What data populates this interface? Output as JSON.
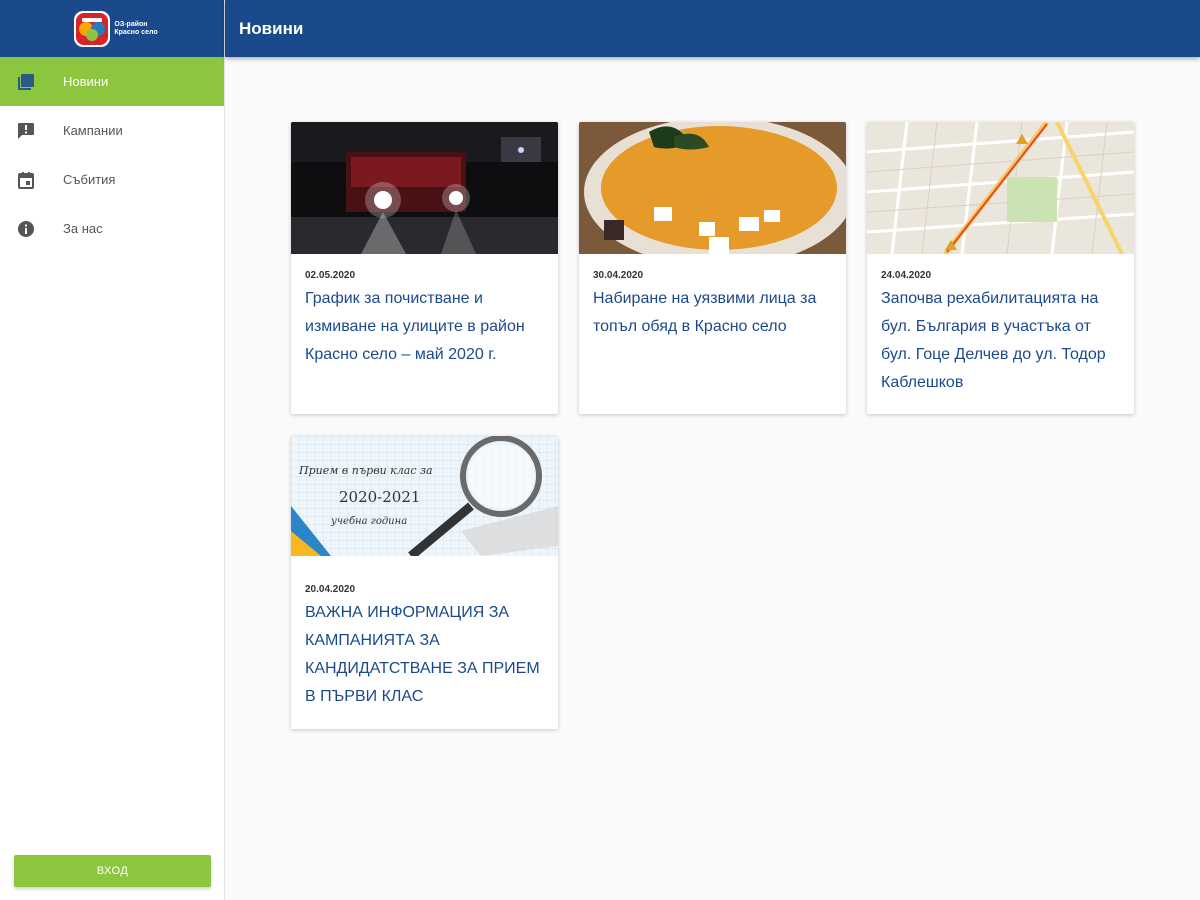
{
  "logo": {
    "line1": "ОЗ-район",
    "line2": "Красно село"
  },
  "header": {
    "title": "Новини"
  },
  "sidebar": {
    "items": [
      {
        "label": "Новини",
        "icon": "news-icon",
        "active": true
      },
      {
        "label": "Кампании",
        "icon": "announcement-icon",
        "active": false
      },
      {
        "label": "Събития",
        "icon": "calendar-icon",
        "active": false
      },
      {
        "label": "За нас",
        "icon": "info-icon",
        "active": false
      }
    ],
    "login_label": "вход"
  },
  "news": [
    {
      "date": "02.05.2020",
      "title": "График за почистване и измиване на улиците в район Красно село – май 2020 г.",
      "image": "night-street-cleaning-truck"
    },
    {
      "date": "30.04.2020",
      "title": "Набиране на уязвими лица за топъл обяд в Красно село",
      "image": "soup-bowl"
    },
    {
      "date": "24.04.2020",
      "title": "Започва рехабилитацията на бул. България в участъка от бул. Гоце Делчев до ул. Тодор Каблешков",
      "image": "street-map"
    },
    {
      "date": "20.04.2020",
      "title": "ВАЖНА ИНФОРМАЦИЯ ЗА КАМПАНИЯТА ЗА КАНДИДАТСТВАНЕ ЗА ПРИЕМ В ПЪРВИ КЛАС",
      "image": "school-admission-banner",
      "image_text": [
        "Прием в първи клас за",
        "2020-2021",
        "учебна година"
      ]
    }
  ],
  "colors": {
    "primary": "#1b4a8c",
    "accent": "#8cc63f"
  }
}
